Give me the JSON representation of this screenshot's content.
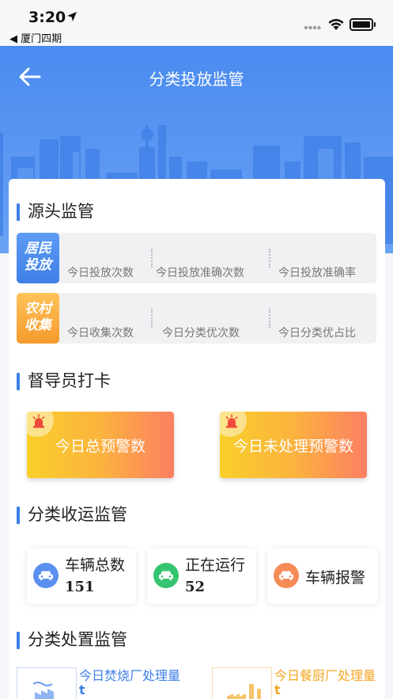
{
  "status_bar": {
    "time": "3:20",
    "back_app": "◀ 厦门四期"
  },
  "header": {
    "title": "分类投放监管"
  },
  "sections": {
    "source": "源头监管",
    "supervisor": "督导员打卡",
    "transport": "分类收运监管",
    "disposal": "分类处置监管"
  },
  "source_rows": [
    {
      "badge_line1": "居民",
      "badge_line2": "投放",
      "labels": [
        "今日投放次数",
        "今日投放准确次数",
        "今日投放准确率"
      ]
    },
    {
      "badge_line1": "农村",
      "badge_line2": "收集",
      "labels": [
        "今日收集次数",
        "今日分类优次数",
        "今日分类优占比"
      ]
    }
  ],
  "alerts": [
    {
      "label": "今日总预警数"
    },
    {
      "label": "今日未处理预警数"
    }
  ],
  "vehicles": [
    {
      "label": "车辆总数",
      "value": "151",
      "color": "#5b8ff0"
    },
    {
      "label": "正在运行",
      "value": "52",
      "color": "#35c46f"
    },
    {
      "label": "车辆报警",
      "value": "",
      "color": "#f68a57"
    }
  ],
  "disposal": [
    {
      "label": "今日焚烧厂处理量",
      "unit": "t",
      "color": "#3d7fe8"
    },
    {
      "label": "今日餐厨厂处理量",
      "unit": "t",
      "color": "#f5a623"
    }
  ],
  "colors": {
    "brand_blue": "#4a8bf0",
    "accent_bar": "#3d7fe8",
    "alert_gradient_start": "#f9cf2a",
    "alert_gradient_end": "#fd7f63"
  }
}
